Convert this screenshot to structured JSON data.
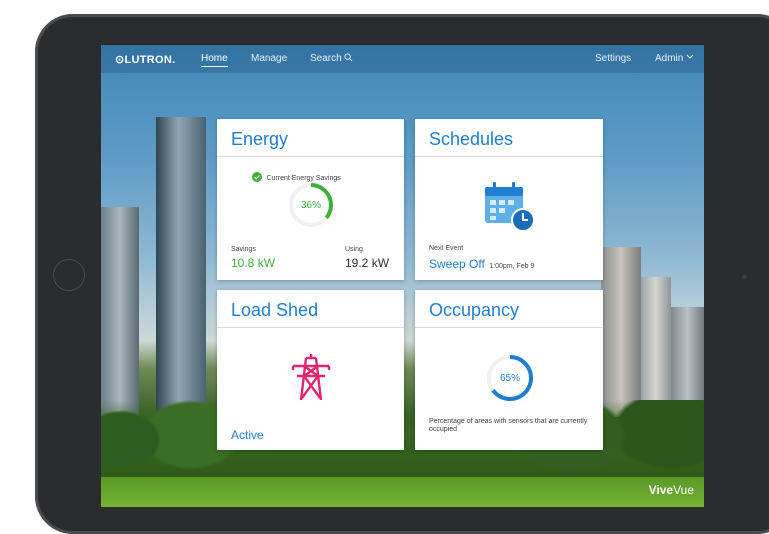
{
  "header": {
    "logo": "⊙LUTRON.",
    "nav": [
      "Home",
      "Manage",
      "Search"
    ],
    "settings": "Settings",
    "admin": "Admin"
  },
  "energy": {
    "title": "Energy",
    "savings_label": "Current Energy Savings",
    "percent": "36%",
    "progress": 0.36,
    "savings_title": "Savings",
    "savings_value": "10.8 kW",
    "using_title": "Using",
    "using_value": "19.2 kW"
  },
  "schedules": {
    "title": "Schedules",
    "next_event_label": "Next Event",
    "event_name": "Sweep Off",
    "event_time": "1:00pm, Feb 9"
  },
  "loadshed": {
    "title": "Load Shed",
    "status": "Active"
  },
  "occupancy": {
    "title": "Occupancy",
    "percent": "65%",
    "progress": 0.65,
    "description": "Percentage of areas with sensors that are currently occupied"
  },
  "footer": {
    "brand_bold": "Vive",
    "brand_light": "Vue"
  },
  "colors": {
    "accent": "#1f7ecf",
    "green": "#3fae3a",
    "pink": "#e5236e"
  }
}
